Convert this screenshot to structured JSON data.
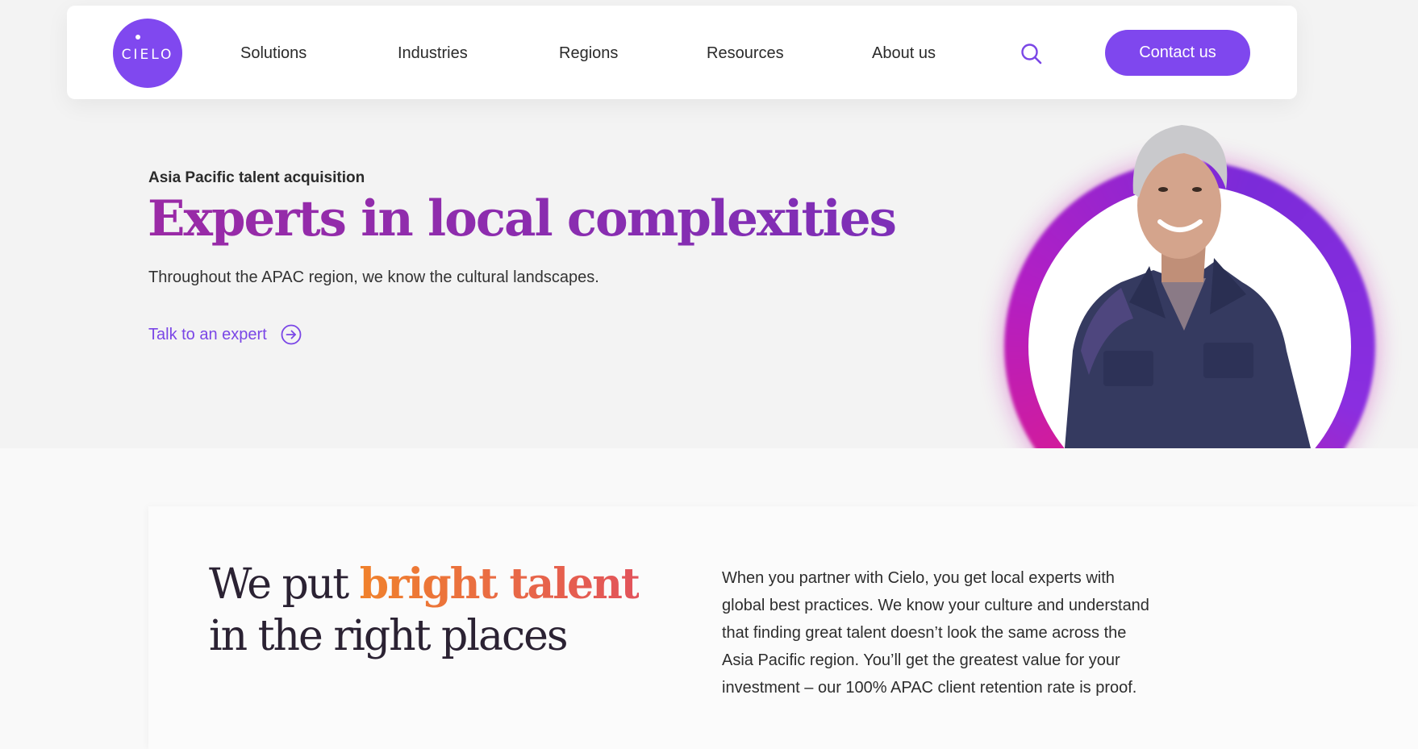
{
  "brand": {
    "logo_text": "CIELO",
    "color_primary": "#7f47ee",
    "color_title_gradient_start": "#9a2aa6",
    "color_accent_orange": "#f0822c"
  },
  "nav": {
    "items": [
      {
        "label": "Solutions"
      },
      {
        "label": "Industries"
      },
      {
        "label": "Regions"
      },
      {
        "label": "Resources"
      },
      {
        "label": "About us"
      }
    ],
    "search_icon": "search-icon",
    "contact_label": "Contact us"
  },
  "hero": {
    "eyebrow": "Asia Pacific talent acquisition",
    "title": "Experts in local complexities",
    "subtitle": "Throughout the APAC region, we know the cultural landscapes.",
    "cta_label": "Talk to an expert",
    "cta_icon": "arrow-right-circle-icon"
  },
  "lower": {
    "title_prefix": "We put ",
    "title_accent": "bright talent",
    "title_suffix": "in the right places",
    "body": "When you partner with Cielo, you get local experts with global best practices. We know your culture and understand that finding great talent doesn’t look the same across the Asia Pacific region. You’ll get the greatest value for your investment – our 100% APAC client retention rate is proof."
  }
}
